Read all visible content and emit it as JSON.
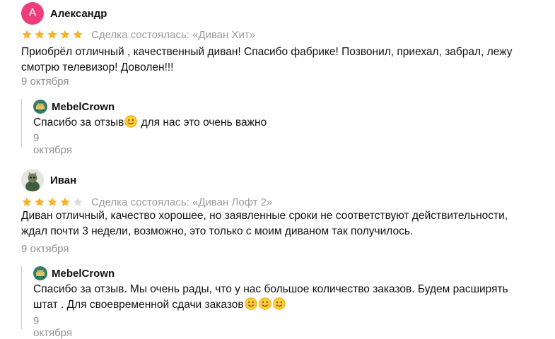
{
  "reviews": [
    {
      "author": "Александр",
      "avatar_letter": "А",
      "rating": 5,
      "deal": "Сделка состоялась: «Диван Хит»",
      "text": "Приобрёл отличный , качественный диван! Спасибо фабрике! Позвонил, приехал, забрал, лежу смотрю телевизор! Доволен!!!",
      "date": "9 октября",
      "reply": {
        "author": "MebelCrown",
        "text_before": "Спасибо за отзыв",
        "text_after": " для нас это очень важно",
        "date": "9 октября"
      }
    },
    {
      "author": "Иван",
      "rating": 4,
      "deal": "Сделка состоялась: «Диван Лофт 2»",
      "text": "Диван отличный, качество хорошее, но заявленные сроки не соответствуют действительности, ждал почти 3 недели, возможно, это только с моим диваном так получилось.",
      "date": "9 октября",
      "reply": {
        "author": "MebelCrown",
        "text_line1": "Спасибо за отзыв. Мы очень рады, что у нас большое количество заказов. Будем расширять",
        "text_line2": "штат . Для своевременной сдачи заказов",
        "date": "9 октября"
      }
    }
  ],
  "colors": {
    "star_filled": "#f7b22b",
    "star_empty": "#dcdcdc",
    "muted_text": "#9b9b9b",
    "avatar_pink": "#ee3e7a",
    "logo_green": "#2f7f6b"
  }
}
